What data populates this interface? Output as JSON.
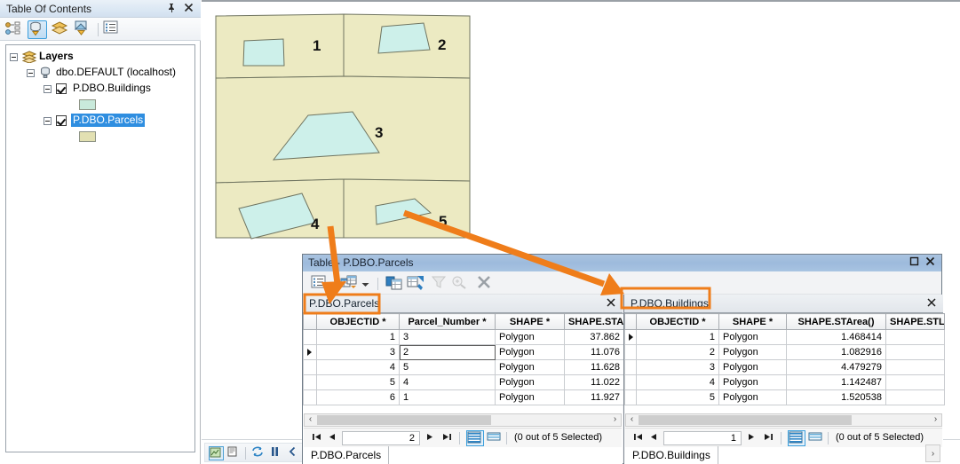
{
  "toc": {
    "title": "Table Of Contents",
    "pin_icon": "pin-icon",
    "close_icon": "close-icon",
    "toolbar": [
      {
        "name": "list-by-drawing-order-icon",
        "selected": false
      },
      {
        "name": "list-by-source-icon",
        "selected": true
      },
      {
        "name": "list-by-visibility-icon",
        "selected": false
      },
      {
        "name": "list-by-selection-icon",
        "selected": false
      },
      {
        "name": "options-icon",
        "selected": false
      }
    ],
    "tree": [
      {
        "label": "Layers",
        "type": "group"
      },
      {
        "label": "dbo.DEFAULT (localhost)",
        "type": "database"
      },
      {
        "label": "P.DBO.Buildings",
        "type": "layer",
        "checked": true,
        "selected": false
      },
      {
        "label": "",
        "type": "symbol",
        "color": "#c9eadb"
      },
      {
        "label": "P.DBO.Parcels",
        "type": "layer",
        "checked": true,
        "selected": true
      },
      {
        "label": "",
        "type": "symbol",
        "color": "#e2e0b2"
      }
    ]
  },
  "map": {
    "parcel_fill": "#eceac2",
    "parcel_stroke": "#6f7460",
    "building_fill": "#cdf0ea",
    "building_stroke": "#6f7460",
    "labels": [
      "1",
      "2",
      "3",
      "4",
      "5"
    ],
    "status_buttons": [
      "data-view-icon",
      "layout-view-icon",
      "refresh-icon",
      "pause-icon",
      "collapse-icon"
    ]
  },
  "table_window": {
    "title": "Table - P.DBO.Parcels",
    "maximize_icon": "maximize-icon",
    "close_icon": "close-icon",
    "toolbar": [
      {
        "name": "table-options-icon"
      },
      {
        "name": "related-tables-icon"
      },
      {
        "name": "dropdown-arrow-icon"
      },
      {
        "name": "show-all-records-icon"
      },
      {
        "name": "show-selected-records-icon"
      },
      {
        "name": "select-by-attributes-icon"
      },
      {
        "name": "zoom-to-selected-icon"
      },
      {
        "name": "clear-selection-icon"
      }
    ],
    "panes": [
      {
        "tab_label": "P.DBO.Parcels",
        "tab_close_icon": "close-icon",
        "highlighted": true,
        "columns": [
          "OBJECTID *",
          "Parcel_Number *",
          "SHAPE *",
          "SHAPE.STArea"
        ],
        "rows": [
          {
            "current": false,
            "cells": [
              "1",
              "3",
              "Polygon",
              "37.862"
            ]
          },
          {
            "current": true,
            "cells": [
              "3",
              "2",
              "Polygon",
              "11.076"
            ],
            "editing_cell": 1
          },
          {
            "current": false,
            "cells": [
              "4",
              "5",
              "Polygon",
              "11.628"
            ]
          },
          {
            "current": false,
            "cells": [
              "5",
              "4",
              "Polygon",
              "11.022"
            ]
          },
          {
            "current": false,
            "cells": [
              "6",
              "1",
              "Polygon",
              "11.927"
            ]
          }
        ],
        "nav": {
          "first_icon": "first-record-icon",
          "prev_icon": "previous-record-icon",
          "record_number": "2",
          "next_icon": "next-record-icon",
          "last_icon": "last-record-icon",
          "show_all_icon": "show-all-rows-icon",
          "show_selected_icon": "show-selected-rows-icon",
          "selection_status": "(0 out of 5 Selected)"
        },
        "bottom_tab": "P.DBO.Parcels"
      },
      {
        "tab_label": "P.DBO.Buildings",
        "tab_close_icon": "close-icon",
        "highlighted": true,
        "columns": [
          "OBJECTID *",
          "SHAPE *",
          "SHAPE.STArea()",
          "SHAPE.STL"
        ],
        "rows": [
          {
            "current": true,
            "cells": [
              "1",
              "Polygon",
              "1.468414",
              ""
            ]
          },
          {
            "current": false,
            "cells": [
              "2",
              "Polygon",
              "1.082916",
              ""
            ]
          },
          {
            "current": false,
            "cells": [
              "3",
              "Polygon",
              "4.479279",
              ""
            ]
          },
          {
            "current": false,
            "cells": [
              "4",
              "Polygon",
              "1.142487",
              ""
            ]
          },
          {
            "current": false,
            "cells": [
              "5",
              "Polygon",
              "1.520538",
              ""
            ]
          }
        ],
        "nav": {
          "first_icon": "first-record-icon",
          "prev_icon": "previous-record-icon",
          "record_number": "1",
          "next_icon": "next-record-icon",
          "last_icon": "last-record-icon",
          "show_all_icon": "show-all-rows-icon",
          "show_selected_icon": "show-selected-rows-icon",
          "selection_status": "(0 out of 5 Selected)"
        },
        "bottom_tab": "P.DBO.Buildings"
      }
    ]
  },
  "annotations": {
    "highlight_color": "#ef7d1a",
    "arrows": [
      {
        "name": "arrow-parcel4-to-parcels-tab"
      },
      {
        "name": "arrow-parcel5-to-buildings-tab"
      }
    ]
  }
}
